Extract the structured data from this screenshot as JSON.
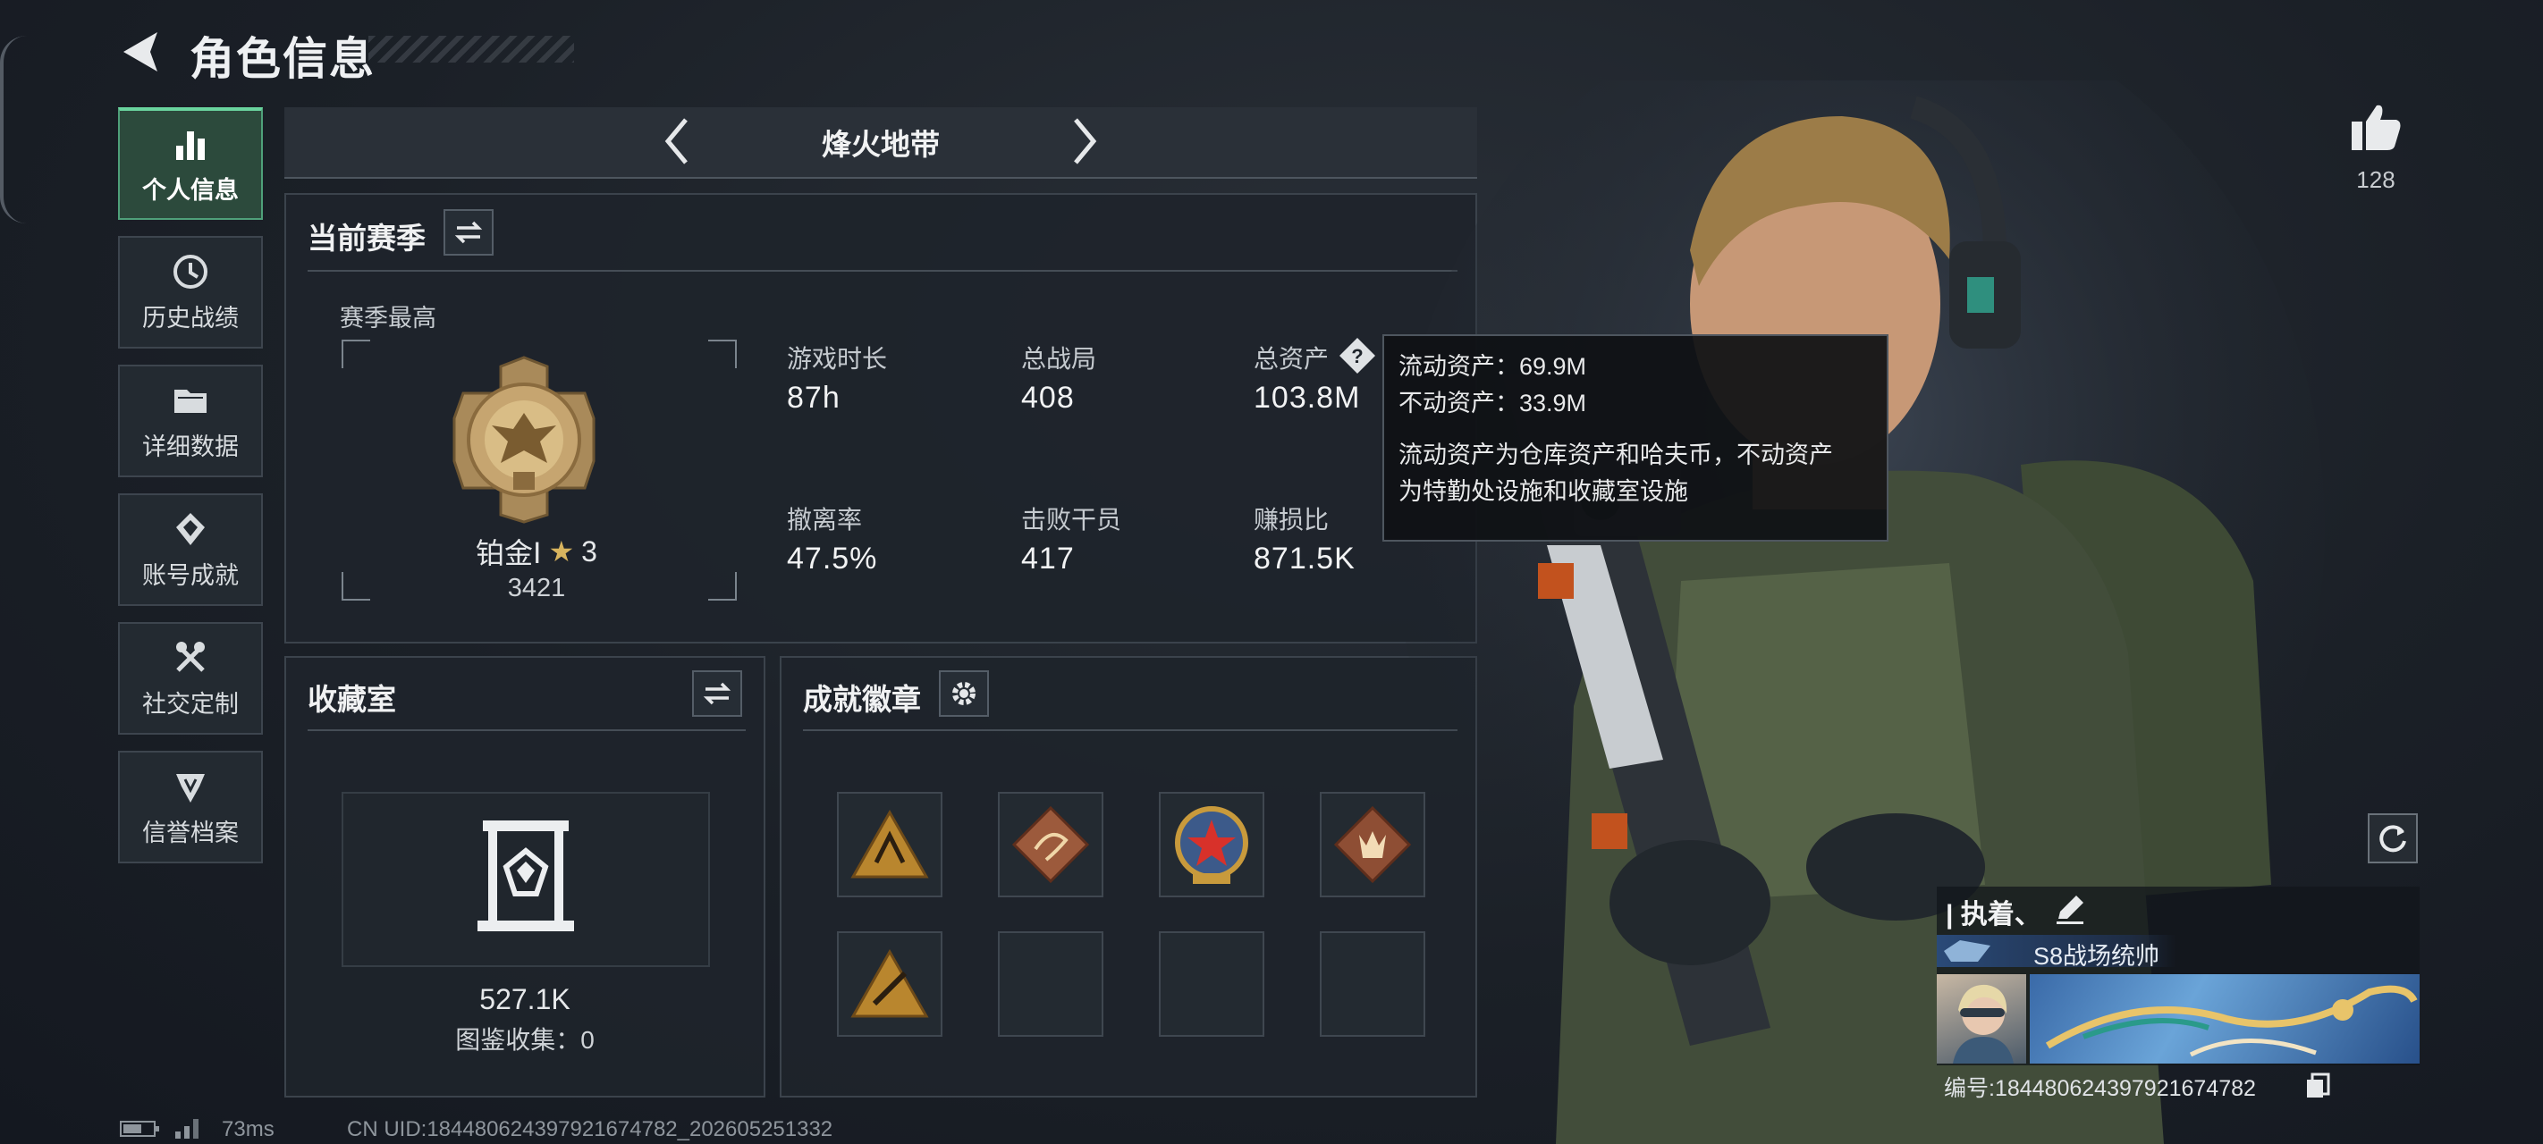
{
  "header": {
    "title": "角色信息"
  },
  "sidebar": {
    "items": [
      {
        "label": "个人信息",
        "icon": "bar-chart-icon",
        "active": true
      },
      {
        "label": "历史战绩",
        "icon": "history-icon",
        "active": false
      },
      {
        "label": "详细数据",
        "icon": "folder-icon",
        "active": false
      },
      {
        "label": "账号成就",
        "icon": "achievement-icon",
        "active": false
      },
      {
        "label": "社交定制",
        "icon": "tools-icon",
        "active": false
      },
      {
        "label": "信誉档案",
        "icon": "credit-icon",
        "active": false
      }
    ]
  },
  "mode": {
    "title": "烽火地带"
  },
  "season": {
    "title": "当前赛季",
    "best_label": "赛季最高",
    "rank_name": "铂金Ⅰ",
    "rank_stars": "3",
    "rank_score": "3421",
    "stats": [
      {
        "label": "游戏时长",
        "value": "87h"
      },
      {
        "label": "总战局",
        "value": "408"
      },
      {
        "label": "总资产",
        "value": "103.8M"
      },
      {
        "label": "撤离率",
        "value": "47.5%"
      },
      {
        "label": "击败干员",
        "value": "417"
      },
      {
        "label": "赚损比",
        "value": "871.5K"
      }
    ]
  },
  "tooltip": {
    "line1": "流动资产：69.9M",
    "line2": "不动资产：33.9M",
    "note1": "流动资产为仓库资产和哈夫币，不动资产",
    "note2": "为特勤处设施和收藏室设施"
  },
  "collection": {
    "title": "收藏室",
    "value": "527.1K",
    "count_text": "图鉴收集：0"
  },
  "badges": {
    "title": "成就徽章",
    "filled": 5,
    "total": 8
  },
  "likes": {
    "count": "128"
  },
  "profile": {
    "status": "| 执着、",
    "title": "S8战场统帅",
    "id_text": "编号:18448062439792167​4782"
  },
  "status_bar": {
    "ping": "73ms",
    "uid": "CN UID:18448062439792167​4782_202605251332"
  },
  "colors": {
    "accent": "#6ad49e",
    "panel": "#1e242b",
    "border": "#3b434c"
  }
}
